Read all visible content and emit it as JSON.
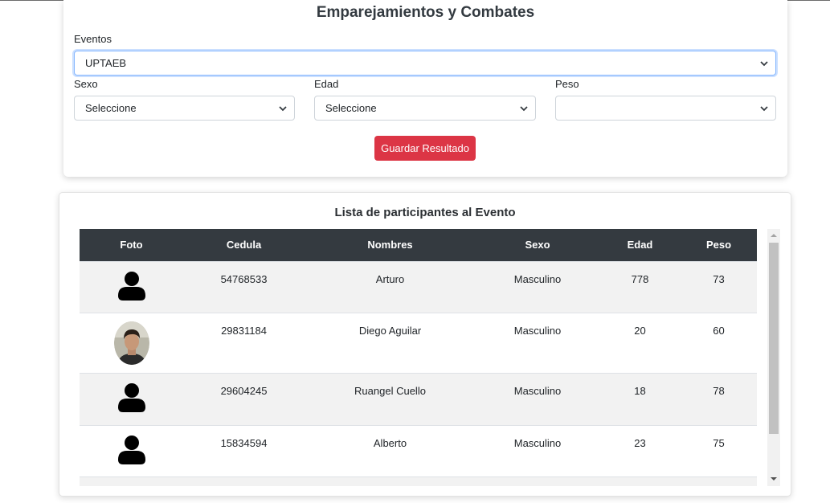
{
  "form": {
    "title": "Emparejamientos y Combates",
    "eventos_label": "Eventos",
    "eventos_value": "UPTAEB",
    "sexo_label": "Sexo",
    "sexo_value": "Seleccione",
    "edad_label": "Edad",
    "edad_value": "Seleccione",
    "peso_label": "Peso",
    "peso_value": "",
    "save_label": "Guardar Resultado"
  },
  "table": {
    "title": "Lista de participantes al Evento",
    "headers": [
      "Foto",
      "Cedula",
      "Nombres",
      "Sexo",
      "Edad",
      "Peso"
    ],
    "rows": [
      {
        "foto": "generic-user-icon",
        "cedula": "54768533",
        "nombre": "Arturo",
        "sexo": "Masculino",
        "edad": "778",
        "peso": "73"
      },
      {
        "foto": "profile-photo",
        "cedula": "29831184",
        "nombre": "Diego Aguilar",
        "sexo": "Masculino",
        "edad": "20",
        "peso": "60"
      },
      {
        "foto": "generic-user-icon",
        "cedula": "29604245",
        "nombre": "Ruangel Cuello",
        "sexo": "Masculino",
        "edad": "18",
        "peso": "78"
      },
      {
        "foto": "generic-user-icon",
        "cedula": "15834594",
        "nombre": "Alberto",
        "sexo": "Masculino",
        "edad": "23",
        "peso": "75"
      }
    ]
  },
  "colors": {
    "header_bg": "#343a40",
    "save_button": "#dc3545",
    "focus_border": "#86b7fe"
  }
}
